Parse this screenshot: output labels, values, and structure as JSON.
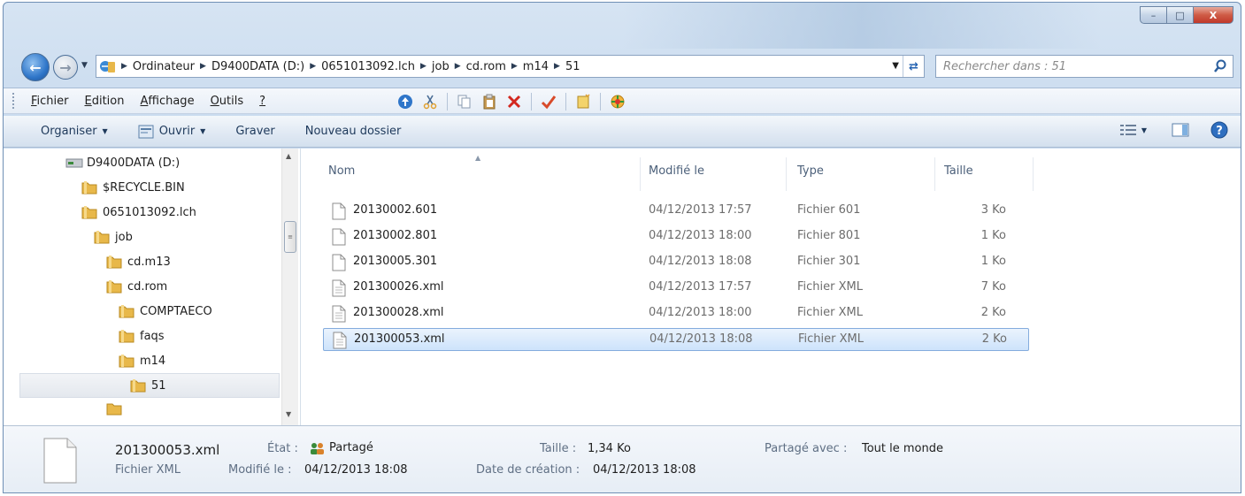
{
  "window": {
    "controls": {
      "minimize": "–",
      "maximize": "□",
      "close": "X"
    }
  },
  "address": {
    "breadcrumbs": [
      "Ordinateur",
      "D9400DATA (D:)",
      "0651013092.lch",
      "job",
      "cd.rom",
      "m14",
      "51"
    ],
    "search_placeholder": "Rechercher dans : 51"
  },
  "menubar": {
    "items": [
      "Fichier",
      "Edition",
      "Affichage",
      "Outils",
      "?"
    ],
    "accelerators": [
      "F",
      "E",
      "A",
      "O",
      "?"
    ]
  },
  "commandbar": {
    "organize": "Organiser",
    "open": "Ouvrir",
    "burn": "Graver",
    "new_folder": "Nouveau dossier"
  },
  "navtree": {
    "items": [
      {
        "label": "D9400DATA (D:)",
        "icon": "drive-icon"
      },
      {
        "label": "$RECYCLE.BIN",
        "icon": "folder-icon"
      },
      {
        "label": "0651013092.lch",
        "icon": "folder-icon"
      },
      {
        "label": "job",
        "icon": "folder-icon"
      },
      {
        "label": "cd.m13",
        "icon": "folder-icon"
      },
      {
        "label": "cd.rom",
        "icon": "folder-icon"
      },
      {
        "label": "COMPTAECO",
        "icon": "folder-icon"
      },
      {
        "label": "faqs",
        "icon": "folder-icon"
      },
      {
        "label": "m14",
        "icon": "folder-icon"
      },
      {
        "label": "51",
        "icon": "folder-icon",
        "selected": true
      }
    ]
  },
  "filelist": {
    "columns": [
      "Nom",
      "Modifié le",
      "Type",
      "Taille"
    ],
    "rows": [
      {
        "name": "20130002.601",
        "modified": "04/12/2013 17:57",
        "type": "Fichier 601",
        "size": "3 Ko"
      },
      {
        "name": "20130002.801",
        "modified": "04/12/2013 18:00",
        "type": "Fichier 801",
        "size": "1 Ko"
      },
      {
        "name": "20130005.301",
        "modified": "04/12/2013 18:08",
        "type": "Fichier 301",
        "size": "1 Ko"
      },
      {
        "name": "201300026.xml",
        "modified": "04/12/2013 17:57",
        "type": "Fichier XML",
        "size": "7 Ko"
      },
      {
        "name": "201300028.xml",
        "modified": "04/12/2013 18:00",
        "type": "Fichier XML",
        "size": "2 Ko"
      },
      {
        "name": "201300053.xml",
        "modified": "04/12/2013 18:08",
        "type": "Fichier XML",
        "size": "2 Ko",
        "selected": true
      }
    ]
  },
  "details": {
    "filename": "201300053.xml",
    "filetype": "Fichier XML",
    "state_label": "État :",
    "state_value": "Partagé",
    "modified_label": "Modifié le :",
    "modified_value": "04/12/2013 18:08",
    "size_label": "Taille :",
    "size_value": "1,34 Ko",
    "created_label": "Date de création :",
    "created_value": "04/12/2013 18:08",
    "shared_label": "Partagé avec :",
    "shared_value": "Tout le monde"
  },
  "colors": {
    "selection_bg": "#cde3fb",
    "selection_border": "#84acdd",
    "folder": "#e8b84a",
    "accent_blue": "#2f76c9"
  }
}
